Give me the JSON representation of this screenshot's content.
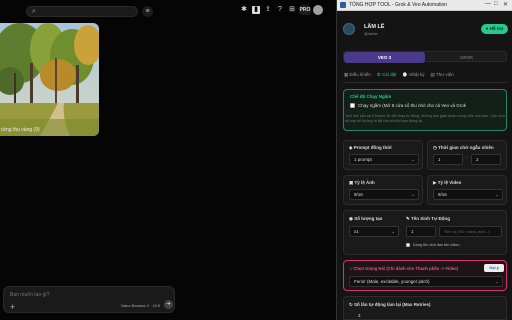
{
  "left": {
    "search": {
      "icon": "search-icon",
      "placeholder": ""
    },
    "top_icons": [
      "settings-icon",
      "bookmark-icon",
      "share-icon",
      "help-icon",
      "grid-icon"
    ],
    "pro_badge": "PRO",
    "photo_caption": "rừng thu vàng (9)",
    "prompt": {
      "placeholder": "Bạn muốn tạo gì?",
      "model_chip": "Nano Banana 2 · 16:9"
    }
  },
  "panel": {
    "titlebar": {
      "title": "TỔNG HỢP TOOL - Grok & Veo Automation",
      "controls": [
        "—",
        "□",
        "✕"
      ]
    },
    "user": {
      "name": "LÂM LÊ",
      "handle": "@lamle",
      "support_button": "Hỗ trợ"
    },
    "modes": [
      {
        "label": "VEO 3",
        "active": true
      },
      {
        "label": "GROK",
        "active": false
      }
    ],
    "tabs": [
      {
        "label": "Điều khiển",
        "icon": "control-icon",
        "active": false
      },
      {
        "label": "Cài đặt",
        "icon": "gear-icon",
        "active": true
      },
      {
        "label": "Nhật ký",
        "icon": "log-icon",
        "active": false
      },
      {
        "label": "Thư viện",
        "icon": "library-icon",
        "active": false
      }
    ],
    "test_mode": {
      "title": "Chế độ Chạy Ngầm",
      "checkbox_label": "Chạy ngầm (Mở 8 cửa sổ thu nhỏ cho cả Veo và Grok",
      "hint": "Tool mở sẵn và Chrome ẩn để chạy tự động, không làm gián đoạn công việc của bạn. Các cửa sổ này sẽ không bị tắt cho tới khi bạn đóng lại."
    },
    "prompt_concurrency": {
      "label": "Prompt đồng thời",
      "value": "1 prompt"
    },
    "random_wait": {
      "label": "Thời gian chờ ngẫu nhiên",
      "min": "1",
      "max": "2"
    },
    "image_ratio": {
      "label": "Tỷ lệ Ảnh",
      "value": "9/16"
    },
    "video_ratio": {
      "label": "Tỷ lệ Video",
      "value": "9/16"
    },
    "count": {
      "label": "Số lượng tạo",
      "value": "x1"
    },
    "auto_name": {
      "label": "Tên Sinh Tự Động",
      "start": "1",
      "placeholder": "Tiền tố (VD: video_anh...)",
      "checkbox_label": "Dùng tên ảnh làm tên video"
    },
    "voice": {
      "label": "Chọn Giọng Nói (Chỉ dành cho Thanh phần -> Video)",
      "value": "Fenrir (Male, excitable, younger pitch)",
      "preview": "Gọi ý"
    },
    "retries": {
      "label": "Số lần tự động làm lại (Max Retries)",
      "value": "2"
    }
  },
  "colors": {
    "accent_green": "#27c98c",
    "accent_purple": "#4b3a8c",
    "alert_pink": "#d6336c"
  }
}
